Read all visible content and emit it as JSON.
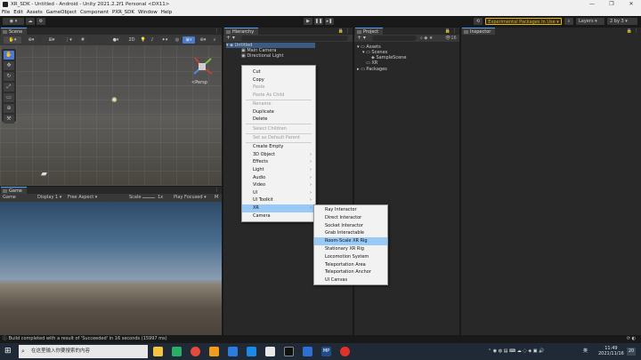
{
  "window": {
    "title": "XR_SDK - Untitled - Android - Unity 2021.2.2f1 Personal <DX11>",
    "controls": [
      "—",
      "❐",
      "✕"
    ]
  },
  "menubar": [
    "File",
    "Edit",
    "Assets",
    "GameObject",
    "Component",
    "PXR_SDK",
    "Window",
    "Help"
  ],
  "toolbar": {
    "experimental_label": "Experimental Packages In Use ▾",
    "layers_label": "Layers",
    "layout_label": "2 by 3"
  },
  "scene": {
    "tab_label": "Scene",
    "persp_label": "<Persp"
  },
  "game": {
    "tab_label": "Game",
    "toolbar": {
      "mode": "Game",
      "display": "Display 1 ▾",
      "aspect": "Free Aspect ▾",
      "scale_label": "Scale",
      "scale_value": "1x",
      "play_focused": "Play Focused ▾",
      "more": "M"
    }
  },
  "hierarchy": {
    "tab_label": "Hierarchy",
    "scene_name": "Untitled",
    "objects": [
      "Main Camera",
      "Directional Light"
    ]
  },
  "project": {
    "tab_label": "Project",
    "hidden_count": "16",
    "tree": [
      {
        "label": "Assets",
        "indent": 0
      },
      {
        "label": "Scenes",
        "indent": 1
      },
      {
        "label": "SampleScene",
        "indent": 2
      },
      {
        "label": "XR",
        "indent": 1
      },
      {
        "label": "Packages",
        "indent": 0
      }
    ]
  },
  "inspector": {
    "tab_label": "Inspector"
  },
  "context_menu": {
    "items": [
      {
        "label": "Cut",
        "disabled": false
      },
      {
        "label": "Copy",
        "disabled": false
      },
      {
        "label": "Paste",
        "disabled": true
      },
      {
        "label": "Paste As Child",
        "disabled": true
      },
      {
        "sep": true
      },
      {
        "label": "Rename",
        "disabled": true
      },
      {
        "label": "Duplicate",
        "disabled": false
      },
      {
        "label": "Delete",
        "disabled": false
      },
      {
        "sep": true
      },
      {
        "label": "Select Children",
        "disabled": true
      },
      {
        "sep": true
      },
      {
        "label": "Set as Default Parent",
        "disabled": true
      },
      {
        "sep": true
      },
      {
        "label": "Create Empty",
        "disabled": false
      },
      {
        "label": "3D Object",
        "disabled": false,
        "submenu": true
      },
      {
        "label": "Effects",
        "disabled": false,
        "submenu": true
      },
      {
        "label": "Light",
        "disabled": false,
        "submenu": true
      },
      {
        "label": "Audio",
        "disabled": false,
        "submenu": true
      },
      {
        "label": "Video",
        "disabled": false,
        "submenu": true
      },
      {
        "label": "UI",
        "disabled": false,
        "submenu": true
      },
      {
        "label": "UI Toolkit",
        "disabled": false,
        "submenu": true
      },
      {
        "label": "XR",
        "disabled": false,
        "submenu": true,
        "highlighted": true
      },
      {
        "label": "Camera",
        "disabled": false
      }
    ]
  },
  "xr_submenu": {
    "items": [
      {
        "label": "Ray Interactor"
      },
      {
        "label": "Direct Interactor"
      },
      {
        "label": "Socket Interactor"
      },
      {
        "label": "Grab Interactable"
      },
      {
        "label": "Room-Scale XR Rig",
        "highlighted": true
      },
      {
        "label": "Stationary XR Rig"
      },
      {
        "label": "Locomotion System"
      },
      {
        "label": "Teleportation Area"
      },
      {
        "label": "Teleportation Anchor"
      },
      {
        "label": "UI Canvas"
      }
    ]
  },
  "statusbar": {
    "message": "Build completed with a result of 'Succeeded' in 16 seconds (15997 ms)"
  },
  "taskbar": {
    "search_placeholder": "在这里输入你要搜索的内容",
    "time": "11:49",
    "date": "2021/11/16",
    "ime": "英",
    "notifications": "20"
  },
  "colors": {
    "accent": "#4f9ef7",
    "menu_highlight": "#99c9f5",
    "experimental_badge": "#e8b400"
  }
}
